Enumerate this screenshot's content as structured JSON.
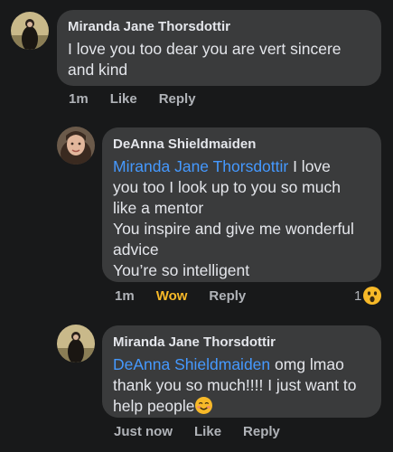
{
  "colors": {
    "background": "#18191a",
    "bubble": "#3a3b3c",
    "text": "#e4e6eb",
    "muted": "#b0b3b8",
    "mention": "#4599ff",
    "wow": "#f7b928"
  },
  "comments": [
    {
      "author": "Miranda Jane Thorsdottir",
      "lines": [
        "I love you too dear you are vert sincere",
        "and kind"
      ],
      "time": "1m",
      "like_label": "Like",
      "reply_label": "Reply"
    },
    {
      "author": "DeAnna Shieldmaiden",
      "mention": "Miranda Jane Thorsdottir",
      "first_line_rest": " I love",
      "lines": [
        "you too I look up to you so much",
        "like a mentor",
        "You inspire and give me wonderful",
        "advice",
        "You’re so intelligent"
      ],
      "time": "1m",
      "like_label": "Wow",
      "reply_label": "Reply",
      "reaction_count": "1",
      "reaction_icon": "wow-emoji-icon"
    },
    {
      "author": "Miranda Jane Thorsdottir",
      "mention": "DeAnna Shieldmaiden",
      "first_line_rest": " omg lmao",
      "lines": [
        "thank you so much!!!! I just want to",
        "help people"
      ],
      "trailing_emoji": "smiling-blush-emoji-icon",
      "time": "Just now",
      "like_label": "Like",
      "reply_label": "Reply"
    }
  ]
}
